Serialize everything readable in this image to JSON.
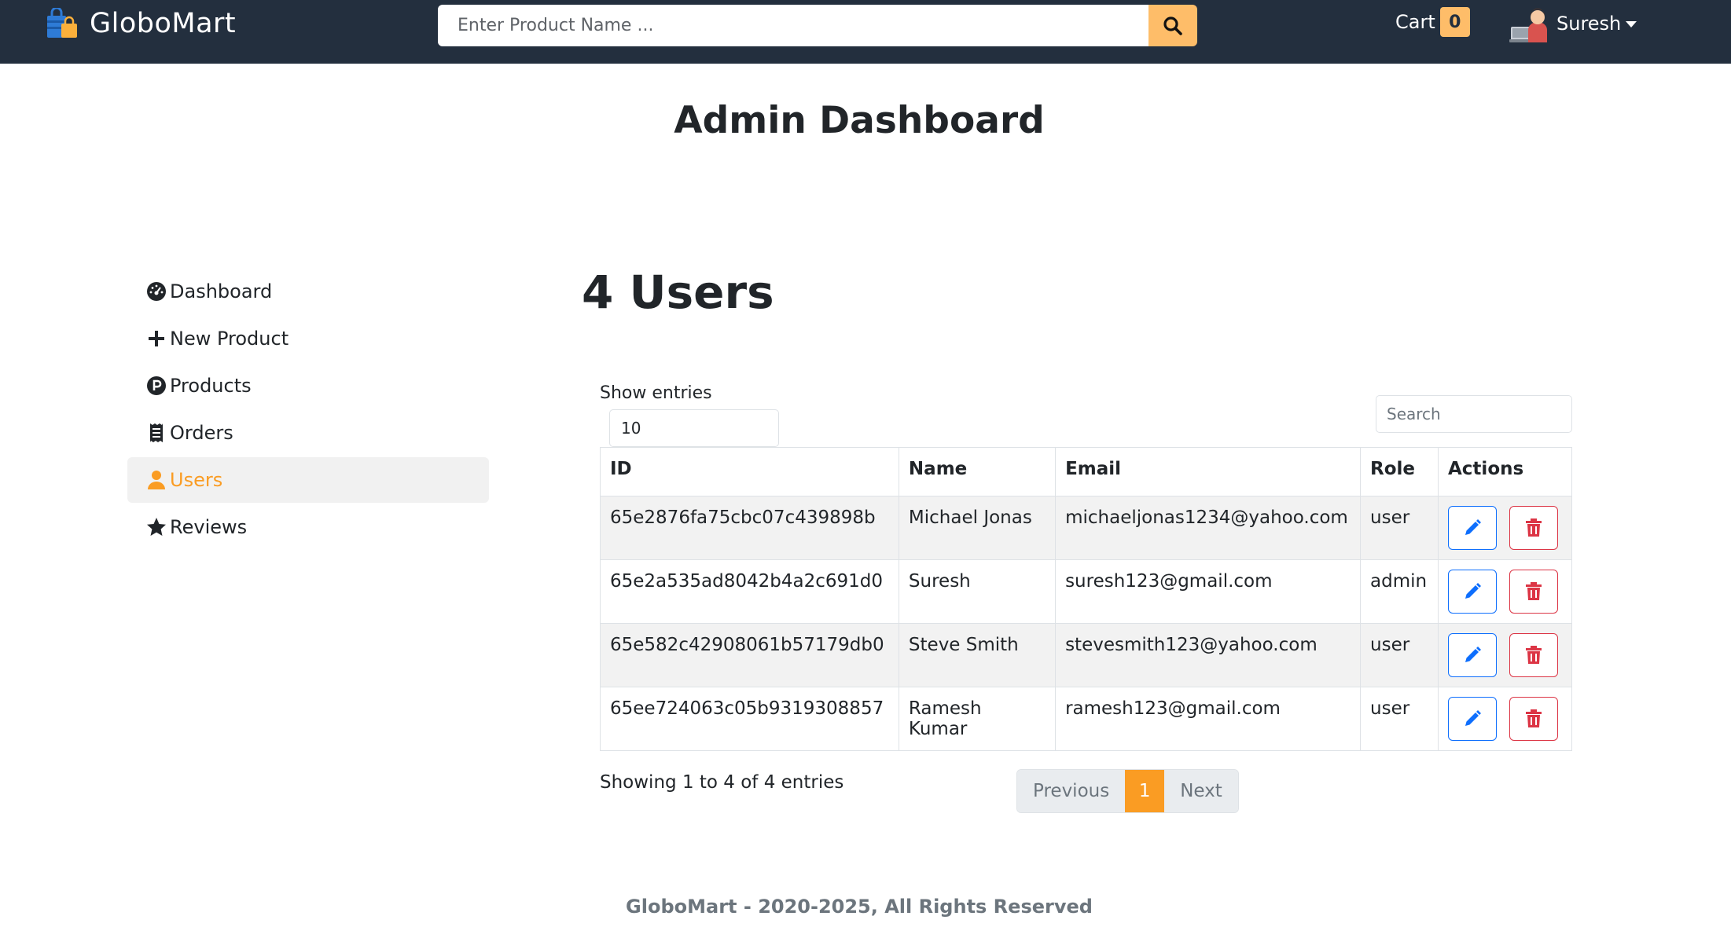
{
  "navbar": {
    "brand": "GloboMart",
    "search_placeholder": "Enter Product Name ...",
    "cart_label": "Cart",
    "cart_count": "0",
    "user_name": "Suresh"
  },
  "page_title": "Admin Dashboard",
  "sidebar": {
    "items": [
      {
        "label": "Dashboard",
        "icon": "dashboard-gauge-icon"
      },
      {
        "label": "New Product",
        "icon": "plus-icon"
      },
      {
        "label": "Products",
        "icon": "product-circle-icon"
      },
      {
        "label": "Orders",
        "icon": "receipt-icon"
      },
      {
        "label": "Users",
        "icon": "user-icon",
        "active": true
      },
      {
        "label": "Reviews",
        "icon": "star-icon"
      }
    ]
  },
  "main": {
    "heading": "4 Users",
    "show_entries_label": "Show entries",
    "entries_value": "10",
    "search_placeholder": "Search",
    "columns": [
      "ID",
      "Name",
      "Email",
      "Role",
      "Actions"
    ],
    "rows": [
      {
        "id": "65e2876fa75cbc07c439898b",
        "name": "Michael Jonas",
        "email": "michaeljonas1234@yahoo.com",
        "role": "user"
      },
      {
        "id": "65e2a535ad8042b4a2c691d0",
        "name": "Suresh",
        "email": "suresh123@gmail.com",
        "role": "admin"
      },
      {
        "id": "65e582c42908061b57179db0",
        "name": "Steve Smith",
        "email": "stevesmith123@yahoo.com",
        "role": "user"
      },
      {
        "id": "65ee724063c05b9319308857",
        "name": "Ramesh Kumar",
        "email": "ramesh123@gmail.com",
        "role": "user"
      }
    ],
    "showing_info": "Showing 1 to 4 of 4 entries",
    "pagination": {
      "previous": "Previous",
      "current": "1",
      "next": "Next"
    }
  },
  "footer": "GloboMart - 2020-2025, All Rights Reserved",
  "colors": {
    "navbar_bg": "#232f3e",
    "accent": "#febd69",
    "active_orange": "#fa9c23",
    "edit_blue": "#0d6efd",
    "delete_red": "#dc3545"
  }
}
